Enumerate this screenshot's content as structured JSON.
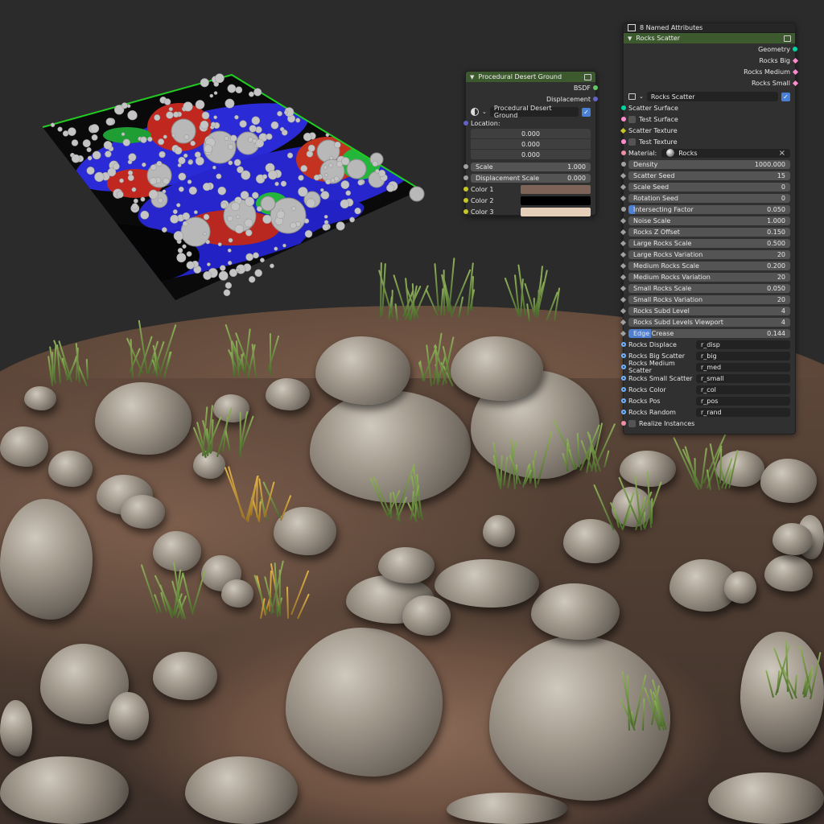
{
  "colors": {
    "node_header": "#3d5a2e",
    "socket_geometry": "#00d6a3",
    "socket_shader": "#63c763",
    "socket_vector": "#6363c7",
    "socket_float": "#a1a1a1",
    "socket_color": "#c7c729",
    "socket_string": "#70b2ff",
    "socket_instance": "#ff8ccf",
    "accent_blue": "#4f7fd0"
  },
  "desert_node": {
    "title": "Procedural Desert Ground",
    "outputs": [
      "BSDF",
      "Displacement"
    ],
    "material_selector": "Procedural Desert Ground",
    "location_label": "Location:",
    "location_values": [
      "0.000",
      "0.000",
      "0.000"
    ],
    "scale": {
      "label": "Scale",
      "value": "1.000"
    },
    "displacement_scale": {
      "label": "Displacement Scale",
      "value": "0.000"
    },
    "colors": [
      {
        "label": "Color 1",
        "hex": "#7e6458"
      },
      {
        "label": "Color 2",
        "hex": "#000000"
      },
      {
        "label": "Color 3",
        "hex": "#e6cfb8"
      }
    ]
  },
  "rocks_node": {
    "attributes_title": "8 Named Attributes",
    "title": "Rocks Scatter",
    "outputs": [
      "Geometry",
      "Rocks Big",
      "Rocks Medium",
      "Rocks Small"
    ],
    "group_selector": "Rocks Scatter",
    "inputs_top": [
      {
        "label": "Scatter Surface",
        "type": "geometry"
      },
      {
        "label": "Test Surface",
        "type": "bool"
      },
      {
        "label": "Scatter Texture",
        "type": "color"
      },
      {
        "label": "Test Texture",
        "type": "bool"
      }
    ],
    "material": {
      "label": "Material:",
      "value": "Rocks"
    },
    "params": [
      {
        "label": "Density",
        "value": "1000.000"
      },
      {
        "label": "Scatter Seed",
        "value": "15"
      },
      {
        "label": "Scale Seed",
        "value": "0"
      },
      {
        "label": "Rotation Seed",
        "value": "0"
      },
      {
        "label": "Intersecting Factor",
        "value": "0.050"
      },
      {
        "label": "Noise Scale",
        "value": "1.000"
      },
      {
        "label": "Rocks Z Offset",
        "value": "0.150"
      },
      {
        "label": "Large Rocks Scale",
        "value": "0.500"
      },
      {
        "label": "Large Rocks Variation",
        "value": "20"
      },
      {
        "label": "Medium Rocks Scale",
        "value": "0.200"
      },
      {
        "label": "Medium Rocks Variation",
        "value": "20"
      },
      {
        "label": "Small Rocks Scale",
        "value": "0.050"
      },
      {
        "label": "Small Rocks Variation",
        "value": "20"
      },
      {
        "label": "Rocks Subd Level",
        "value": "4"
      },
      {
        "label": "Rocks Subd Levels Viewport",
        "value": "4"
      },
      {
        "label": "Edge Crease",
        "value": "0.144"
      }
    ],
    "named_attrs": [
      {
        "label": "Rocks Displace",
        "value": "r_disp"
      },
      {
        "label": "Rocks Big Scatter",
        "value": "r_big"
      },
      {
        "label": "Rocks Medium Scatter",
        "value": "r_med"
      },
      {
        "label": "Rocks Small Scatter",
        "value": "r_small"
      },
      {
        "label": "Rocks Color",
        "value": "r_col"
      },
      {
        "label": "Rocks Pos",
        "value": "r_pos"
      },
      {
        "label": "Rocks Random",
        "value": "r_rand"
      }
    ],
    "realize_instances": "Realize Instances"
  }
}
